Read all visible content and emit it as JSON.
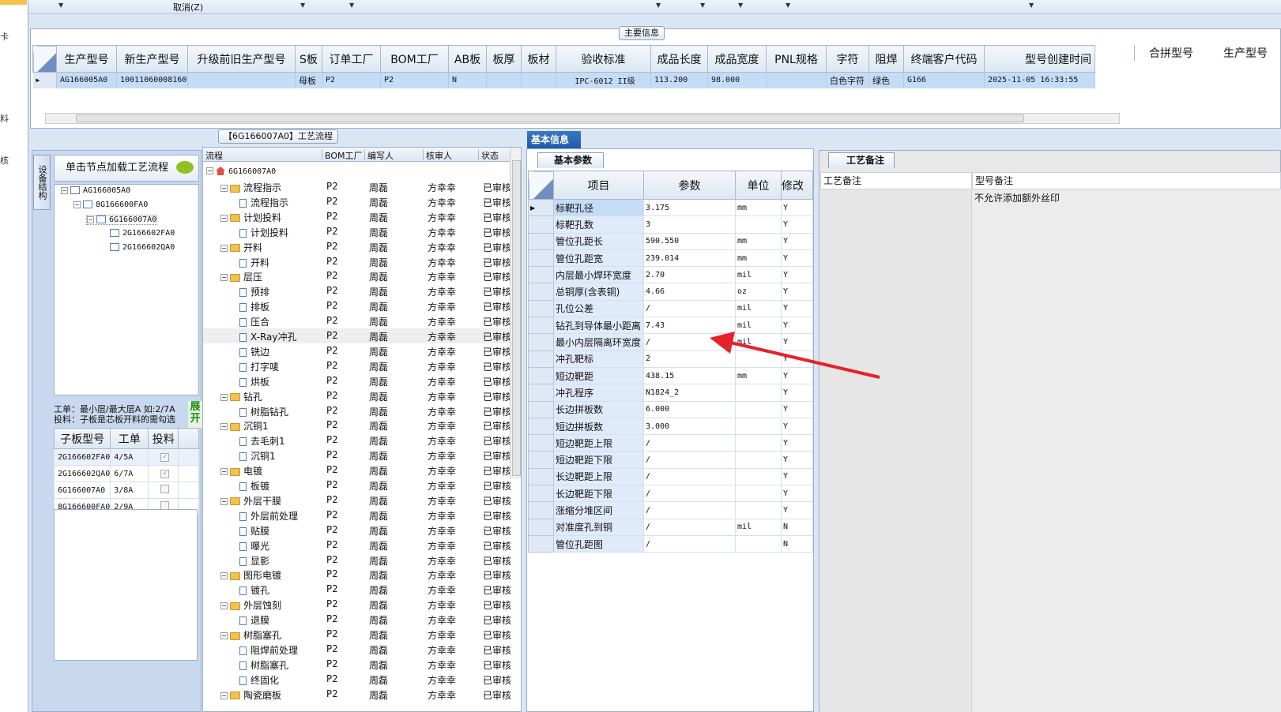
{
  "toolbar": {
    "cancel_label": "取消(Z)"
  },
  "left_strip": {
    "chars": [
      "卡",
      "料",
      "核"
    ]
  },
  "main_info": {
    "group_label": "主要信息",
    "columns": [
      "生产型号",
      "新生产型号",
      "升级前旧生产型号",
      "S板",
      "订单工厂",
      "BOM工厂",
      "AB板",
      "板厚",
      "板材",
      "验收标准",
      "成品长度",
      "成品宽度",
      "PNL规格",
      "字符",
      "阻焊",
      "终端客户代码",
      "型号创建时间"
    ],
    "extra_columns": [
      "合拼型号",
      "生产型号"
    ],
    "row": [
      "AG166005A0",
      "10011060008160",
      "",
      "母板",
      "P2",
      "P2",
      "N",
      "",
      "",
      "IPC-6012 II级",
      "113.200",
      "98.000",
      "",
      "白色字符",
      "绿色",
      "G166",
      "2025-11-05 16:33:55"
    ]
  },
  "structure": {
    "vtab_label": "设备结构",
    "load_button": "单击节点加载工艺流程",
    "tree": [
      "AG166005A0",
      "8G166600FA0",
      "6G166007A0",
      "2G166602FA0",
      "2G166602QA0"
    ],
    "hint_line1": "工单：最小层/最大层A 如:2/7A",
    "hint_line2": "投料：子板是芯板开料的需勾选",
    "expand_label": "展开",
    "sub_columns": [
      "子板型号",
      "工单",
      "投料"
    ],
    "sub_rows": [
      {
        "model": "2G166602FA0",
        "order": "4/5A",
        "checked": "✓"
      },
      {
        "model": "2G166602QA0",
        "order": "6/7A",
        "checked": "✓"
      },
      {
        "model": "6G166007A0",
        "order": "3/8A",
        "checked": ""
      },
      {
        "model": "8G166600FA0",
        "order": "2/9A",
        "checked": ""
      }
    ]
  },
  "flow": {
    "tab_label": "【6G166007A0】工艺流程",
    "columns": [
      "流程",
      "BOM工厂",
      "编写人",
      "核审人",
      "状态"
    ],
    "root": "6G166007A0",
    "factory": "P2",
    "writer": "周磊",
    "reviewer": "方幸幸",
    "status": "已审核",
    "rows": [
      {
        "name": "流程指示",
        "folder": true
      },
      {
        "name": "流程指示",
        "folder": false
      },
      {
        "name": "计划投料",
        "folder": true
      },
      {
        "name": "计划投料",
        "folder": false
      },
      {
        "name": "开料",
        "folder": true
      },
      {
        "name": "开料",
        "folder": false
      },
      {
        "name": "层压",
        "folder": true
      },
      {
        "name": "预排",
        "folder": false
      },
      {
        "name": "排板",
        "folder": false
      },
      {
        "name": "压合",
        "folder": false
      },
      {
        "name": "X-Ray冲孔",
        "folder": false
      },
      {
        "name": "铣边",
        "folder": false
      },
      {
        "name": "打字唛",
        "folder": false
      },
      {
        "name": "烘板",
        "folder": false
      },
      {
        "name": "钻孔",
        "folder": true
      },
      {
        "name": "树脂钻孔",
        "folder": false
      },
      {
        "name": "沉铜1",
        "folder": true
      },
      {
        "name": "去毛刺1",
        "folder": false
      },
      {
        "name": "沉铜1",
        "folder": false
      },
      {
        "name": "电镀",
        "folder": true
      },
      {
        "name": "板镀",
        "folder": false
      },
      {
        "name": "外层干膜",
        "folder": true
      },
      {
        "name": "外层前处理",
        "folder": false
      },
      {
        "name": "贴膜",
        "folder": false
      },
      {
        "name": "曝光",
        "folder": false
      },
      {
        "name": "显影",
        "folder": false
      },
      {
        "name": "图形电镀",
        "folder": true
      },
      {
        "name": "镀孔",
        "folder": false
      },
      {
        "name": "外层蚀刻",
        "folder": true
      },
      {
        "name": "退膜",
        "folder": false
      },
      {
        "name": "树脂塞孔",
        "folder": true
      },
      {
        "name": "阻焊前处理",
        "folder": false
      },
      {
        "name": "树脂塞孔",
        "folder": false
      },
      {
        "name": "终固化",
        "folder": false
      },
      {
        "name": "陶瓷磨板",
        "folder": true
      }
    ]
  },
  "basic": {
    "tab_label": "基本信息",
    "subtab_label": "基本参数",
    "columns": [
      "项目",
      "参数",
      "单位",
      "修改"
    ],
    "rows": [
      {
        "item": "标靶孔径",
        "value": "3.175",
        "unit": "mm",
        "mod": "Y"
      },
      {
        "item": "标靶孔数",
        "value": "3",
        "unit": "",
        "mod": "Y"
      },
      {
        "item": "管位孔距长",
        "value": "590.550",
        "unit": "mm",
        "mod": "Y"
      },
      {
        "item": "管位孔距宽",
        "value": "239.014",
        "unit": "mm",
        "mod": "Y"
      },
      {
        "item": "内层最小焊环宽度",
        "value": "2.70",
        "unit": "mil",
        "mod": "Y"
      },
      {
        "item": "总铜厚(含表铜)",
        "value": "4.66",
        "unit": "oz",
        "mod": "Y"
      },
      {
        "item": "孔位公差",
        "value": "/",
        "unit": "mil",
        "mod": "Y"
      },
      {
        "item": "钻孔到导体最小距离",
        "value": "7.43",
        "unit": "mil",
        "mod": "Y"
      },
      {
        "item": "最小内层隔离环宽度",
        "value": "/",
        "unit": "mil",
        "mod": "Y"
      },
      {
        "item": "冲孔靶标",
        "value": "2",
        "unit": "",
        "mod": "Y"
      },
      {
        "item": "短边靶距",
        "value": "438.15",
        "unit": "mm",
        "mod": "Y"
      },
      {
        "item": "冲孔程序",
        "value": "N1824_2",
        "unit": "",
        "mod": "Y"
      },
      {
        "item": "长边拼板数",
        "value": "6.000",
        "unit": "",
        "mod": "Y"
      },
      {
        "item": "短边拼板数",
        "value": "3.000",
        "unit": "",
        "mod": "Y"
      },
      {
        "item": "短边靶距上限",
        "value": "/",
        "unit": "",
        "mod": "Y"
      },
      {
        "item": "短边靶距下限",
        "value": "/",
        "unit": "",
        "mod": "Y"
      },
      {
        "item": "长边靶距上限",
        "value": "/",
        "unit": "",
        "mod": "Y"
      },
      {
        "item": "长边靶距下限",
        "value": "/",
        "unit": "",
        "mod": "Y"
      },
      {
        "item": "涨缩分堆区间",
        "value": "/",
        "unit": "",
        "mod": "Y"
      },
      {
        "item": "对准度孔到铜",
        "value": "/",
        "unit": "mil",
        "mod": "N"
      },
      {
        "item": "管位孔距图",
        "value": "/",
        "unit": "",
        "mod": "N"
      }
    ]
  },
  "remarks": {
    "tab_label": "工艺备注",
    "col1_label": "工艺备注",
    "col2_label": "型号备注",
    "model_remark": "不允许添加额外丝印"
  },
  "colors": {
    "selection": "#c5dcf7",
    "tab_blue": "#1f5aa8",
    "arrow": "#e8202a"
  }
}
